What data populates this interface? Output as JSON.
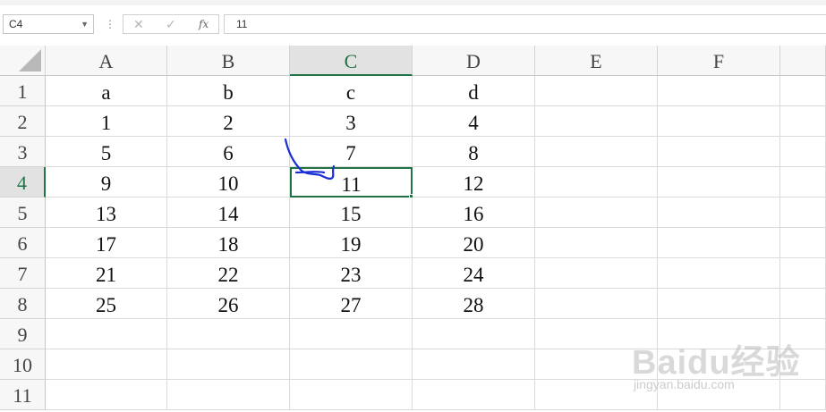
{
  "formula_bar": {
    "name_box": "C4",
    "cancel_icon": "✕",
    "enter_icon": "✓",
    "fx_label": "fx",
    "formula_value": "11"
  },
  "columns": [
    "A",
    "B",
    "C",
    "D",
    "E",
    "F"
  ],
  "rows": [
    {
      "num": "1",
      "cells": [
        "a",
        "b",
        "c",
        "d",
        "",
        ""
      ]
    },
    {
      "num": "2",
      "cells": [
        "1",
        "2",
        "3",
        "4",
        "",
        ""
      ]
    },
    {
      "num": "3",
      "cells": [
        "5",
        "6",
        "7",
        "8",
        "",
        ""
      ]
    },
    {
      "num": "4",
      "cells": [
        "9",
        "10",
        "11",
        "12",
        "",
        ""
      ]
    },
    {
      "num": "5",
      "cells": [
        "13",
        "14",
        "15",
        "16",
        "",
        ""
      ]
    },
    {
      "num": "6",
      "cells": [
        "17",
        "18",
        "19",
        "20",
        "",
        ""
      ]
    },
    {
      "num": "7",
      "cells": [
        "21",
        "22",
        "23",
        "24",
        "",
        ""
      ]
    },
    {
      "num": "8",
      "cells": [
        "25",
        "26",
        "27",
        "28",
        "",
        ""
      ]
    },
    {
      "num": "9",
      "cells": [
        "",
        "",
        "",
        "",
        "",
        ""
      ]
    },
    {
      "num": "10",
      "cells": [
        "",
        "",
        "",
        "",
        "",
        ""
      ]
    },
    {
      "num": "11",
      "cells": [
        "",
        "",
        "",
        "",
        "",
        ""
      ]
    }
  ],
  "selection": {
    "column": "C",
    "row": "4"
  },
  "watermark": {
    "logo": "Baidu经验",
    "url": "jingyan.baidu.com"
  },
  "colors": {
    "accent": "#217346",
    "annotation": "#1a2fd6"
  }
}
